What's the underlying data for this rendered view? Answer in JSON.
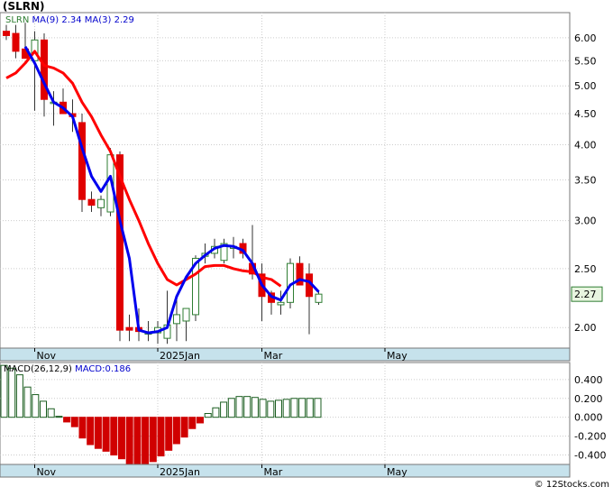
{
  "title": "(SLRN)",
  "watermark": "© 12Stocks.com",
  "colors": {
    "up_candle": "#2e7d32",
    "down_candle": "#e00000",
    "ma_fast": "#ff0000",
    "ma_slow": "#0000ee",
    "macd_pos": "#1b5e20",
    "macd_neg": "#d00000",
    "axis_strip": "#c6e2ec",
    "grid": "#cccccc"
  },
  "chart_data": [
    {
      "type": "candlestick",
      "legend": {
        "ticker": "SLRN",
        "ma9_label": "MA(9)",
        "ma9_value": "2.34",
        "ma3_label": "MA(3)",
        "ma3_value": "2.29"
      },
      "last_price_label": "2.27",
      "y_scale": "log",
      "ylim": [
        1.85,
        6.6
      ],
      "y_ticks": [
        {
          "v": 6.0,
          "label": "6.00"
        },
        {
          "v": 5.5,
          "label": "5.50"
        },
        {
          "v": 5.0,
          "label": "5.00"
        },
        {
          "v": 4.5,
          "label": "4.50"
        },
        {
          "v": 4.0,
          "label": "4.00"
        },
        {
          "v": 3.5,
          "label": "3.50"
        },
        {
          "v": 3.0,
          "label": "3.00"
        },
        {
          "v": 2.5,
          "label": "2.50"
        },
        {
          "v": 2.0,
          "label": "2.00"
        }
      ],
      "x_ticks": [
        {
          "i": 3,
          "label": "Nov"
        },
        {
          "i": 16,
          "label": "2025Jan"
        },
        {
          "i": 27,
          "label": "Mar"
        },
        {
          "i": 40,
          "label": "May"
        }
      ],
      "grid": true,
      "candles": [
        {
          "o": 6.15,
          "h": 6.3,
          "l": 5.95,
          "c": 6.05
        },
        {
          "o": 6.1,
          "h": 6.3,
          "l": 5.55,
          "c": 5.7
        },
        {
          "o": 5.75,
          "h": 6.35,
          "l": 5.55,
          "c": 5.55
        },
        {
          "o": 5.5,
          "h": 6.15,
          "l": 4.55,
          "c": 5.95
        },
        {
          "o": 5.95,
          "h": 6.1,
          "l": 4.45,
          "c": 4.75
        },
        {
          "o": 4.7,
          "h": 4.9,
          "l": 4.3,
          "c": 4.7
        },
        {
          "o": 4.7,
          "h": 4.95,
          "l": 4.5,
          "c": 4.5
        },
        {
          "o": 4.5,
          "h": 4.75,
          "l": 4.2,
          "c": 4.45
        },
        {
          "o": 4.35,
          "h": 4.5,
          "l": 3.1,
          "c": 3.25
        },
        {
          "o": 3.25,
          "h": 3.35,
          "l": 3.1,
          "c": 3.18
        },
        {
          "o": 3.15,
          "h": 3.3,
          "l": 3.05,
          "c": 3.25
        },
        {
          "o": 3.1,
          "h": 3.95,
          "l": 3.05,
          "c": 3.85
        },
        {
          "o": 3.85,
          "h": 3.9,
          "l": 1.9,
          "c": 1.98
        },
        {
          "o": 2.0,
          "h": 2.1,
          "l": 1.9,
          "c": 1.98
        },
        {
          "o": 2.0,
          "h": 2.15,
          "l": 1.9,
          "c": 1.97
        },
        {
          "o": 1.96,
          "h": 2.05,
          "l": 1.9,
          "c": 1.96
        },
        {
          "o": 1.96,
          "h": 2.05,
          "l": 1.88,
          "c": 2.0
        },
        {
          "o": 1.92,
          "h": 2.3,
          "l": 1.88,
          "c": 2.02
        },
        {
          "o": 2.03,
          "h": 2.25,
          "l": 1.9,
          "c": 2.1
        },
        {
          "o": 2.05,
          "h": 2.1,
          "l": 1.9,
          "c": 2.15
        },
        {
          "o": 2.1,
          "h": 2.63,
          "l": 2.05,
          "c": 2.6
        },
        {
          "o": 2.62,
          "h": 2.75,
          "l": 2.55,
          "c": 2.65
        },
        {
          "o": 2.65,
          "h": 2.8,
          "l": 2.6,
          "c": 2.72
        },
        {
          "o": 2.58,
          "h": 2.8,
          "l": 2.55,
          "c": 2.75
        },
        {
          "o": 2.7,
          "h": 2.82,
          "l": 2.6,
          "c": 2.72
        },
        {
          "o": 2.75,
          "h": 2.8,
          "l": 2.6,
          "c": 2.65
        },
        {
          "o": 2.55,
          "h": 2.95,
          "l": 2.4,
          "c": 2.45
        },
        {
          "o": 2.45,
          "h": 2.55,
          "l": 2.05,
          "c": 2.25
        },
        {
          "o": 2.28,
          "h": 2.3,
          "l": 2.1,
          "c": 2.2
        },
        {
          "o": 2.18,
          "h": 2.3,
          "l": 2.1,
          "c": 2.2
        },
        {
          "o": 2.2,
          "h": 2.6,
          "l": 2.15,
          "c": 2.55
        },
        {
          "o": 2.55,
          "h": 2.62,
          "l": 2.35,
          "c": 2.35
        },
        {
          "o": 2.45,
          "h": 2.55,
          "l": 1.95,
          "c": 2.25
        },
        {
          "o": 2.2,
          "h": 2.3,
          "l": 2.18,
          "c": 2.27
        }
      ],
      "candle_index": [
        0,
        1,
        2,
        3,
        4,
        5,
        6,
        7,
        8,
        9,
        10,
        11,
        12,
        13,
        14,
        15,
        16,
        17,
        18,
        19,
        20,
        21,
        22,
        23,
        24,
        25,
        26,
        27,
        28,
        29,
        30,
        31,
        32,
        33
      ],
      "ma_slow_points": [
        {
          "i": 0,
          "v": 5.15
        },
        {
          "i": 1,
          "v": 5.25
        },
        {
          "i": 2,
          "v": 5.45
        },
        {
          "i": 3,
          "v": 5.7
        },
        {
          "i": 4,
          "v": 5.4
        },
        {
          "i": 5,
          "v": 5.35
        },
        {
          "i": 6,
          "v": 5.25
        },
        {
          "i": 7,
          "v": 5.05
        },
        {
          "i": 8,
          "v": 4.7
        },
        {
          "i": 9,
          "v": 4.45
        },
        {
          "i": 10,
          "v": 4.15
        },
        {
          "i": 11,
          "v": 3.9
        },
        {
          "i": 12,
          "v": 3.55
        },
        {
          "i": 13,
          "v": 3.25
        },
        {
          "i": 14,
          "v": 3.0
        },
        {
          "i": 15,
          "v": 2.75
        },
        {
          "i": 16,
          "v": 2.55
        },
        {
          "i": 17,
          "v": 2.4
        },
        {
          "i": 18,
          "v": 2.35
        },
        {
          "i": 19,
          "v": 2.4
        },
        {
          "i": 20,
          "v": 2.45
        },
        {
          "i": 21,
          "v": 2.52
        },
        {
          "i": 22,
          "v": 2.53
        },
        {
          "i": 23,
          "v": 2.53
        },
        {
          "i": 24,
          "v": 2.5
        },
        {
          "i": 25,
          "v": 2.48
        },
        {
          "i": 26,
          "v": 2.47
        },
        {
          "i": 27,
          "v": 2.42
        },
        {
          "i": 28,
          "v": 2.4
        },
        {
          "i": 29,
          "v": 2.34
        }
      ],
      "ma_fast_points": [
        {
          "i": 2,
          "v": 5.8
        },
        {
          "i": 3,
          "v": 5.45
        },
        {
          "i": 4,
          "v": 5.05
        },
        {
          "i": 5,
          "v": 4.7
        },
        {
          "i": 6,
          "v": 4.6
        },
        {
          "i": 7,
          "v": 4.45
        },
        {
          "i": 8,
          "v": 3.95
        },
        {
          "i": 9,
          "v": 3.55
        },
        {
          "i": 10,
          "v": 3.35
        },
        {
          "i": 11,
          "v": 3.55
        },
        {
          "i": 12,
          "v": 3.0
        },
        {
          "i": 13,
          "v": 2.6
        },
        {
          "i": 14,
          "v": 1.98
        },
        {
          "i": 15,
          "v": 1.96
        },
        {
          "i": 16,
          "v": 1.97
        },
        {
          "i": 17,
          "v": 2.0
        },
        {
          "i": 18,
          "v": 2.25
        },
        {
          "i": 19,
          "v": 2.42
        },
        {
          "i": 20,
          "v": 2.55
        },
        {
          "i": 21,
          "v": 2.63
        },
        {
          "i": 22,
          "v": 2.7
        },
        {
          "i": 23,
          "v": 2.73
        },
        {
          "i": 24,
          "v": 2.72
        },
        {
          "i": 25,
          "v": 2.68
        },
        {
          "i": 26,
          "v": 2.55
        },
        {
          "i": 27,
          "v": 2.35
        },
        {
          "i": 28,
          "v": 2.25
        },
        {
          "i": 29,
          "v": 2.22
        },
        {
          "i": 30,
          "v": 2.35
        },
        {
          "i": 31,
          "v": 2.4
        },
        {
          "i": 32,
          "v": 2.38
        },
        {
          "i": 33,
          "v": 2.29
        }
      ]
    },
    {
      "type": "bar",
      "legend": {
        "label": "MACD(26,12,9)",
        "macd_label": "MACD:",
        "macd_value": "0.186"
      },
      "ylim": [
        -0.5,
        0.58
      ],
      "y_ticks": [
        {
          "v": 0.4,
          "label": "0.400"
        },
        {
          "v": 0.2,
          "label": "0.200"
        },
        {
          "v": 0.0,
          "label": "0.000"
        },
        {
          "v": -0.2,
          "label": "-0.200"
        },
        {
          "v": -0.4,
          "label": "-0.400"
        }
      ],
      "x_ticks": [
        {
          "i": 3,
          "label": "Nov"
        },
        {
          "i": 16,
          "label": "2025Jan"
        },
        {
          "i": 27,
          "label": "Mar"
        },
        {
          "i": 40,
          "label": "May"
        }
      ],
      "histogram": [
        0.55,
        0.52,
        0.45,
        0.32,
        0.24,
        0.17,
        0.09,
        0.01,
        -0.05,
        -0.1,
        -0.22,
        -0.29,
        -0.33,
        -0.36,
        -0.4,
        -0.44,
        -0.5,
        -0.52,
        -0.52,
        -0.47,
        -0.41,
        -0.35,
        -0.28,
        -0.21,
        -0.12,
        -0.06,
        0.04,
        0.1,
        0.16,
        0.2,
        0.22,
        0.22,
        0.21,
        0.19,
        0.17,
        0.18,
        0.19,
        0.2,
        0.2,
        0.2,
        0.2
      ]
    }
  ]
}
